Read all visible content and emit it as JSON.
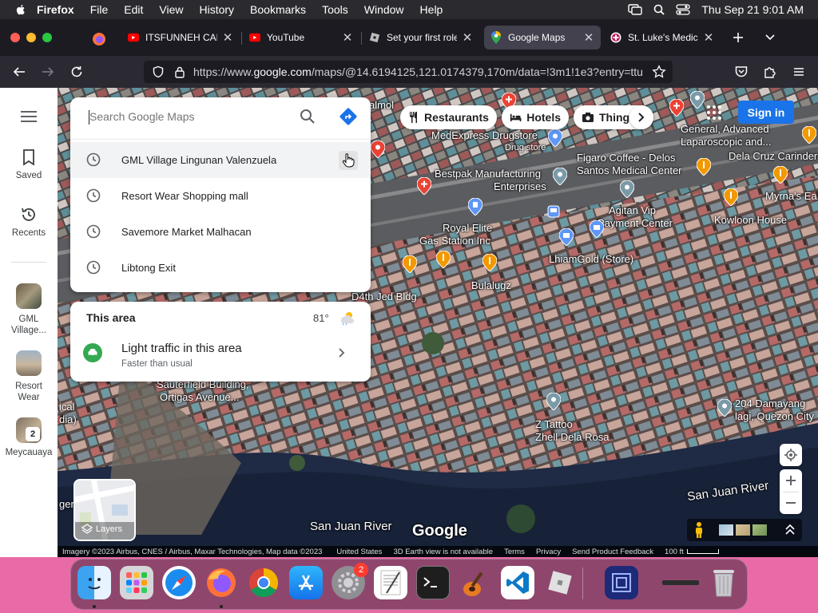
{
  "menubar": {
    "app_name": "Firefox",
    "menus": [
      "File",
      "Edit",
      "View",
      "History",
      "Bookmarks",
      "Tools",
      "Window",
      "Help"
    ],
    "clock": "Thu Sep 21  9:01 AM"
  },
  "tabs": [
    {
      "title": "ITSFUNNEH CALL",
      "icon": "youtube-icon",
      "active": false
    },
    {
      "title": "YouTube",
      "icon": "youtube-icon",
      "active": false
    },
    {
      "title": "Set your first role",
      "icon": "roblox-icon",
      "active": false
    },
    {
      "title": "Google Maps",
      "icon": "maps-icon",
      "active": true
    },
    {
      "title": "St. Luke's Medica",
      "icon": "hospital-icon",
      "active": false
    }
  ],
  "url": {
    "prefix": "https://www.",
    "domain": "google.com",
    "rest": "/maps/@14.6194125,121.0174379,170m/data=!3m1!1e3?entry=ttu"
  },
  "rail": {
    "menu_label": "Menu",
    "saved": "Saved",
    "recents": "Recents",
    "recent_places": [
      {
        "label": "GML Village..."
      },
      {
        "label": "Resort Wear"
      },
      {
        "label": "Meycauaya",
        "badge": "2"
      }
    ]
  },
  "search": {
    "placeholder": "Search Google Maps",
    "suggestions": [
      "GML Village Lingunan Valenzuela",
      "Resort Wear Shopping mall",
      "Savemore Market Malhacan",
      "Libtong Exit"
    ]
  },
  "area": {
    "title": "This area",
    "temperature": "81°",
    "traffic_title": "Light traffic in this area",
    "traffic_subtitle": "Faster than usual"
  },
  "chips": [
    "Restaurants",
    "Hotels",
    "Thing"
  ],
  "signin": "Sign in",
  "map_labels": {
    "l1": "MedExpress Drugstore",
    "l2": "Drug store",
    "l3": "Figaro Coffee - Delos",
    "l4": "Santos Medical Center",
    "l5": "General, Advanced",
    "l6": "Laparoscopic and...",
    "l7": "Dela Cruz Carinder",
    "l8": "Bestpak Manufacturing",
    "l9": "Enterprises",
    "l10": "Agitan Vip",
    "l11": "Payment Center",
    "l12": "Myrna's Ea",
    "l13": "Kowloon House",
    "l14": "Royal Elite",
    "l15": "Gas Station Inc",
    "l16": "LhiamGold (Store)",
    "l17": "Bulalugz",
    "l18": "D4th Jed Bldg",
    "l19": "Sauterfield Building,",
    "l20": "Ortigas Avenue...",
    "l21": "Z Tattoo",
    "l22": "Zhell Dela Rosa",
    "l23": "204 Damayang",
    "l24": "lagi, Quezon City",
    "l25": "San Juan River",
    "l26": "San Juan River",
    "l27": "almol",
    "l28": "ical",
    "l29": "dia)",
    "l30": "ger",
    "google": "Google"
  },
  "layers_label": "Layers",
  "footer": {
    "imagery": "Imagery ©2023 Airbus, CNES / Airbus, Maxar Technologies, Map data ©2023",
    "country": "United States",
    "earth": "3D Earth view is not available",
    "terms": "Terms",
    "privacy": "Privacy",
    "feedback": "Send Product Feedback",
    "scale": "100 ft"
  },
  "dock": {
    "settings_badge": "2"
  }
}
